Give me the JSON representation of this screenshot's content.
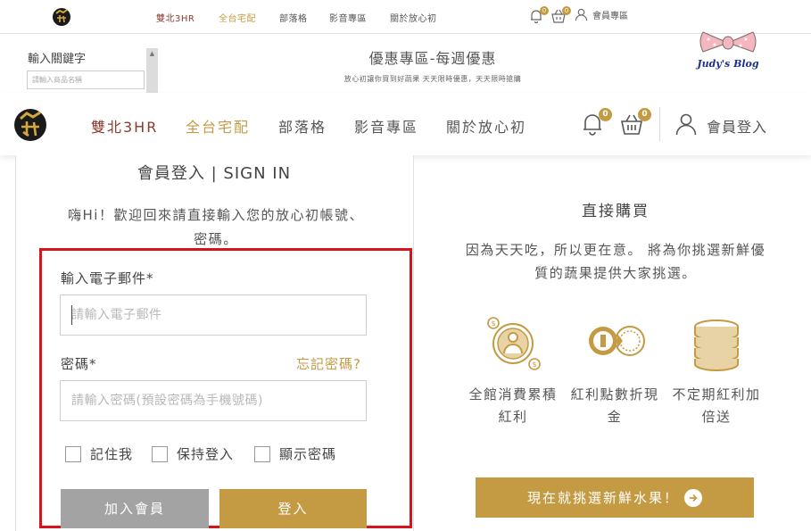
{
  "topbar": {
    "nav": [
      "雙北3HR",
      "全台宅配",
      "部落格",
      "影音專區",
      "關於放心初"
    ],
    "notify_count": "0",
    "cart_count": "0",
    "member_login": "會員專區"
  },
  "search": {
    "label": "輸入關鍵字",
    "placeholder": "請輸入商品名稱"
  },
  "promo": {
    "title": "優惠專區-每週優惠",
    "subtitle": "放心初讓你買到好蔬果 天天限時優惠，天天限時搶購"
  },
  "blog_mark": "Judy's Blog",
  "header": {
    "nav": [
      {
        "label": "雙北3HR",
        "color": "#8a3a2e"
      },
      {
        "label": "全台宅配",
        "color": "#c49a43"
      },
      {
        "label": "部落格",
        "color": "#555555"
      },
      {
        "label": "影音專區",
        "color": "#555555"
      },
      {
        "label": "關於放心初",
        "color": "#555555"
      }
    ],
    "notify_count": "0",
    "cart_count": "0",
    "member_login": "會員登入"
  },
  "login": {
    "title": "會員登入 | SIGN IN",
    "welcome": "嗨Hi！歡迎回來請直接輸入您的放心初帳號、密碼。",
    "email_label": "輸入電子郵件*",
    "email_placeholder": "請輸入電子郵件",
    "password_label": "密碼*",
    "forgot": "忘記密碼?",
    "password_placeholder": "請輸入密碼(預設密碼為手機號碼)",
    "checkboxes": [
      "記住我",
      "保持登入",
      "顯示密碼"
    ],
    "join_button": "加入會員",
    "login_button": "登入"
  },
  "direct": {
    "title": "直接購買",
    "description": "因為天天吃，所以更在意。 將為你挑選新鮮優質的蔬果提供大家挑選。",
    "features": [
      {
        "icon": "member-points-icon",
        "label": "全館消費累積紅利"
      },
      {
        "icon": "coin-exchange-icon",
        "label": "紅利點數折現金"
      },
      {
        "icon": "coin-stack-icon",
        "label": "不定期紅利加倍送"
      }
    ],
    "cta": "現在就挑選新鮮水果！"
  },
  "colors": {
    "gold": "#c49a43",
    "brand_red": "#8a3a2e",
    "highlight": "#d6141a",
    "gray_button": "#a3a3a3"
  }
}
